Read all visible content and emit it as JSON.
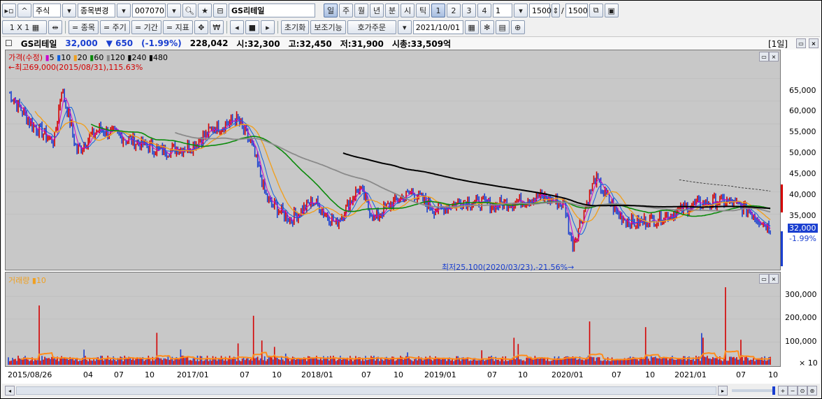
{
  "toolbar1": {
    "market": "주식",
    "change_stock": "종목변경",
    "code": "007070",
    "name": "GS리테일",
    "periods": [
      "일",
      "주",
      "월",
      "년",
      "분",
      "시",
      "틱"
    ],
    "nums": [
      "1",
      "2",
      "3",
      "4"
    ],
    "interval": "1",
    "count": "1500",
    "slash": "/",
    "total": "1500"
  },
  "toolbar2": {
    "layout": "1 X 1",
    "items": [
      "= 종목",
      "= 주기",
      "= 기간",
      "= 지표"
    ],
    "reset": "초기화",
    "aux": "보조기능",
    "order": "호가주문",
    "date": "2021/10/01"
  },
  "info": {
    "name": "GS리테일",
    "price": "32,000",
    "change": "▼ 650",
    "pct": "(-1.99%)",
    "volume": "228,042",
    "open": "시:32,300",
    "high": "고:32,450",
    "low": "저:31,900",
    "mcap": "시총:33,509억",
    "period_badge": "[1일]"
  },
  "price_legend": {
    "price": "가격(수정)",
    "ma": [
      "5",
      "10",
      "20",
      "60",
      "120",
      "240",
      "480"
    ],
    "high_note": "←최고69,000(2015/08/31),115.63%",
    "low_note": "최저25,100(2020/03/23),-21.56%→"
  },
  "volume_legend": {
    "label": "거래량",
    "ma": "10"
  },
  "y_axis_price": [
    "65,000",
    "60,000",
    "55,000",
    "50,000",
    "45,000",
    "40,000",
    "35,000"
  ],
  "last_price": "32,000",
  "last_pct": "-1.99%",
  "y_axis_volume": [
    "300,000",
    "200,000",
    "100,000",
    "× 10"
  ],
  "x_axis": [
    "2015/08/26",
    "04",
    "07",
    "10",
    "2017/01",
    "07",
    "10",
    "2018/01",
    "07",
    "10",
    "2019/01",
    "07",
    "10",
    "2020/01",
    "07",
    "10",
    "2021/01",
    "07",
    "10"
  ],
  "colors": {
    "up": "#d40000",
    "down": "#1a3fd0",
    "ma5": "#cc00cc",
    "ma10": "#1060e0",
    "ma20": "#f0a020",
    "ma60": "#0a8a0a",
    "ma120": "#8a8a8a",
    "ma240": "#000000",
    "vol_ma": "#ff8c1a"
  }
}
